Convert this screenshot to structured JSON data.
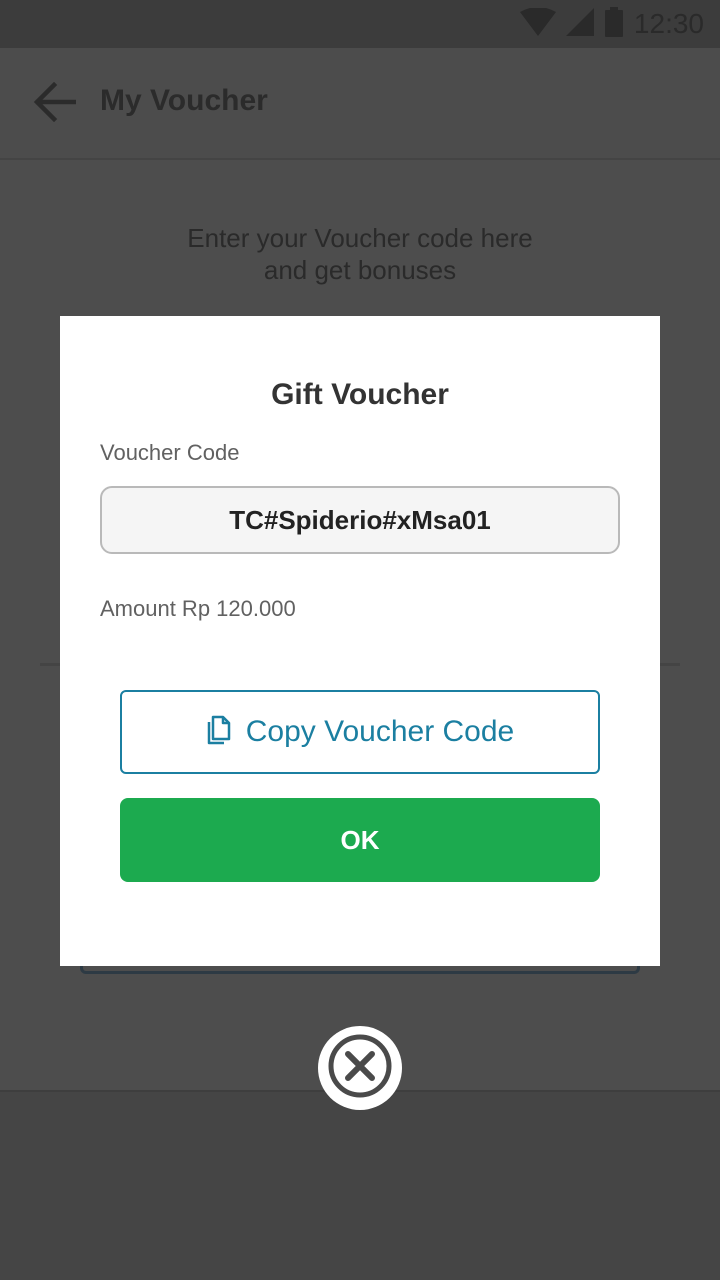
{
  "status_bar": {
    "time": "12:30",
    "icons": [
      "wifi-icon",
      "signal-icon",
      "battery-icon"
    ]
  },
  "app_bar": {
    "title": "My Voucher",
    "back_icon": "arrow-left-icon"
  },
  "main": {
    "intro_line1": "Enter your Voucher code here",
    "intro_line2": "and get bonuses"
  },
  "dialog": {
    "title": "Gift Voucher",
    "code_label": "Voucher Code",
    "code_value": "TC#Spiderio#xMsa01",
    "amount": "Amount Rp 120.000",
    "copy_button": "Copy Voucher Code",
    "copy_icon": "copy-document-icon",
    "ok_button": "OK",
    "close_icon": "close-circle-icon"
  },
  "colors": {
    "accent_blue": "#1b7fa1",
    "ok_green": "#1caa4f",
    "overlay": "#4a4a4a"
  }
}
